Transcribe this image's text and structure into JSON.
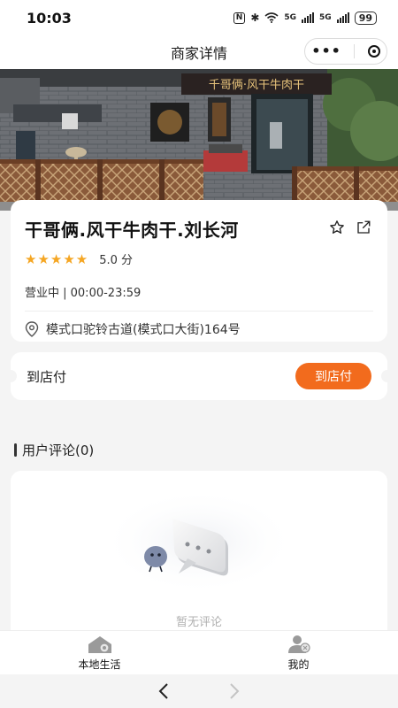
{
  "status": {
    "time": "10:03",
    "network": "5G",
    "battery": "99"
  },
  "navbar": {
    "title": "商家详情",
    "more_icon": "more-dots-icon",
    "target_icon": "target-icon"
  },
  "photo": {
    "signboard": "千哥俩·风干牛肉干"
  },
  "store": {
    "name": "干哥俩.风干牛肉干.刘长河",
    "stars": "★★★★★",
    "rating_text": "5.0 分",
    "hours": "营业中 | 00:00-23:59",
    "address": "模式口驼铃古道(模式口大街)164号",
    "star_color": "#f5a623"
  },
  "payment": {
    "label": "到店付",
    "button_label": "到店付",
    "button_color": "#f26b1d"
  },
  "reviews": {
    "title": "用户评论(0)",
    "empty_text": "暂无评论"
  },
  "tabbar": {
    "tabs": [
      {
        "label": "本地生活",
        "icon": "home-icon"
      },
      {
        "label": "我的",
        "icon": "user-icon"
      }
    ]
  },
  "sysnav": {
    "back_icon": "chevron-left-icon",
    "forward_icon": "chevron-right-icon"
  }
}
